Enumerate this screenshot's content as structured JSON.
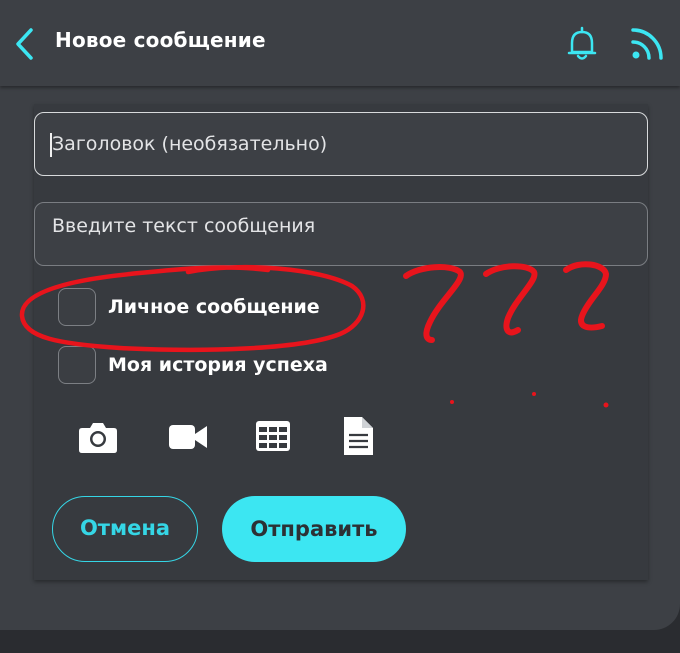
{
  "header": {
    "title": "Новое сообщение",
    "back_icon": "chevron-left-icon",
    "actions": [
      "bell-icon",
      "rss-icon"
    ],
    "accent_color": "#3ce6f2"
  },
  "form": {
    "title_placeholder": "Заголовок (необязательно)",
    "body_placeholder": "Введите текст сообщения",
    "checkboxes": [
      {
        "label": "Личное сообщение",
        "checked": false
      },
      {
        "label": "Моя история успеха",
        "checked": false
      }
    ],
    "attachments": [
      "camera-icon",
      "video-icon",
      "table-icon",
      "document-icon"
    ],
    "cancel_label": "Отмена",
    "submit_label": "Отправить"
  },
  "annotation": {
    "marks": "???",
    "color": "#e8141c"
  }
}
